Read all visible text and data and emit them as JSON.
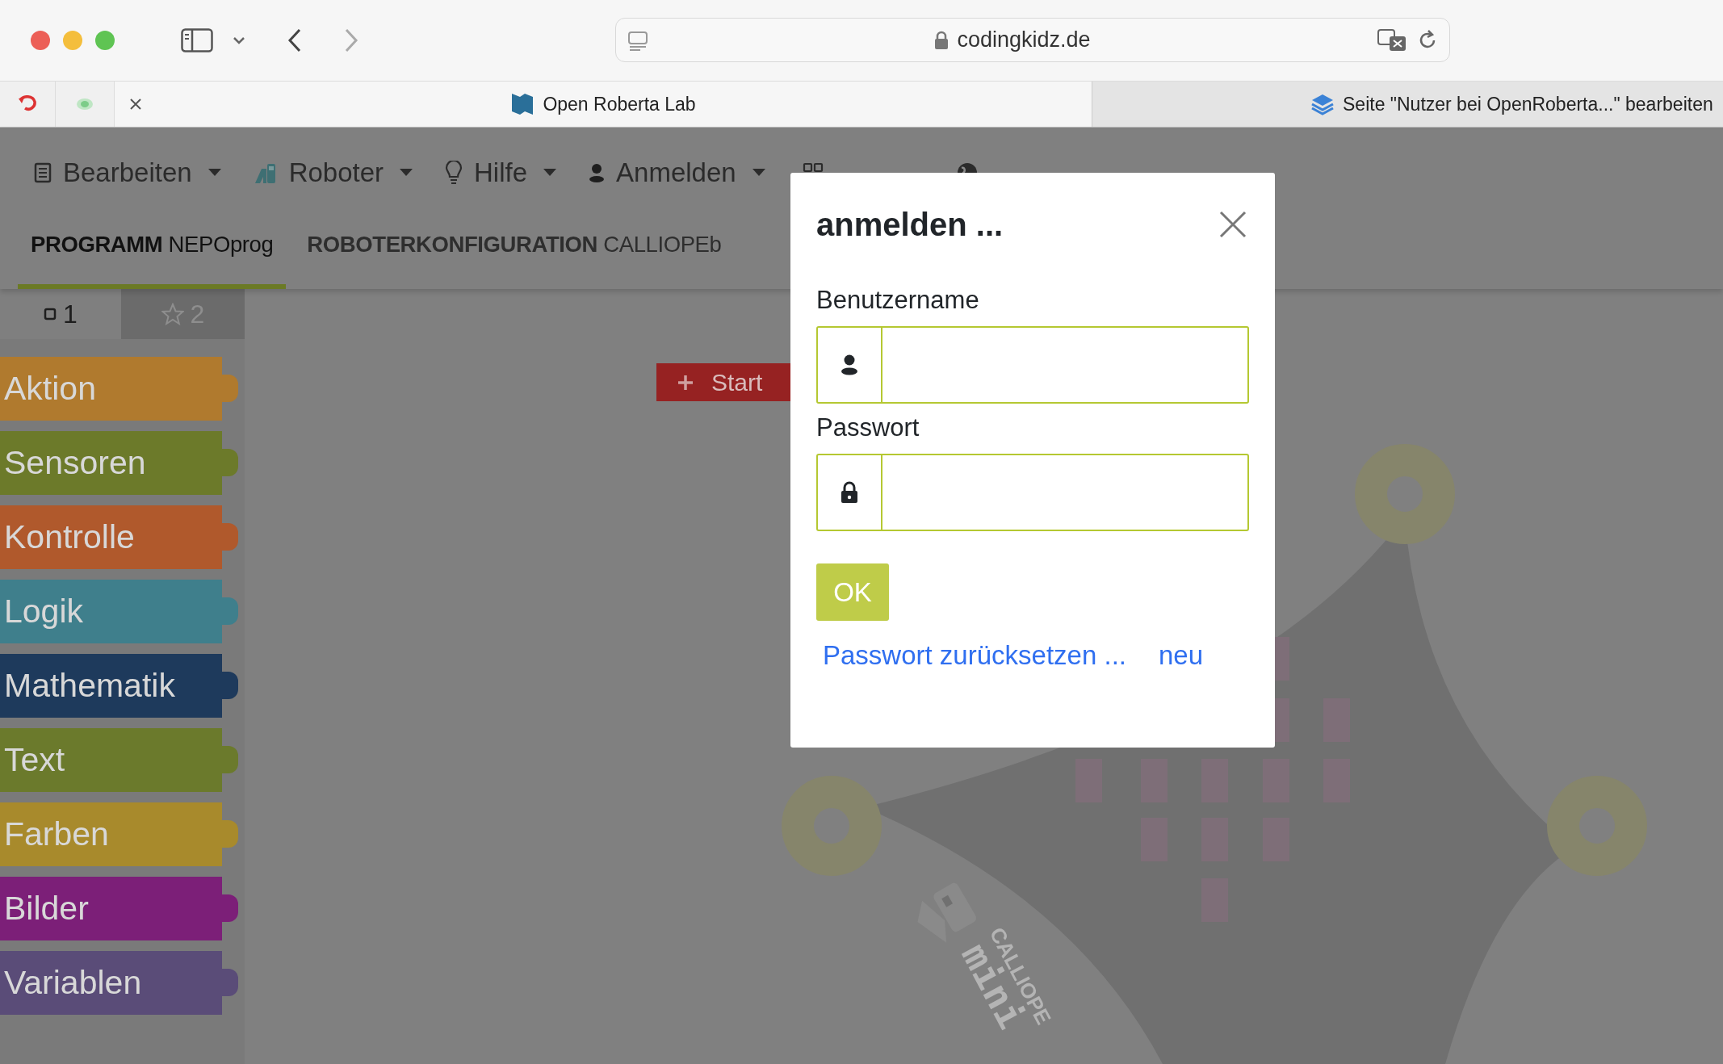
{
  "browser": {
    "address": "codingkidz.de",
    "tabs": [
      {
        "title": "Open Roberta Lab",
        "selected": true
      },
      {
        "title": "Seite \"Nutzer bei OpenRoberta...\" bearbeiten",
        "selected": false
      }
    ]
  },
  "menu": [
    {
      "label": "Bearbeiten"
    },
    {
      "label": "Roboter"
    },
    {
      "label": "Hilfe"
    },
    {
      "label": "Anmelden"
    }
  ],
  "program_tabs": [
    {
      "label": "**PROGRAMM** NEPOprog",
      "selected": true
    },
    {
      "label": "**ROBOTERKONFIGURATION** CALLIOPEb",
      "selected": false
    }
  ],
  "toolbox_tabs": [
    {
      "label": "1",
      "selected": true
    },
    {
      "label": "2",
      "selected": false
    }
  ],
  "toolbox": [
    {
      "label": "Aktion",
      "color": "#b07a2e"
    },
    {
      "label": "Sensoren",
      "color": "#6c7a2a"
    },
    {
      "label": "Kontrolle",
      "color": "#b0592c"
    },
    {
      "label": "Logik",
      "color": "#3f7f8c"
    },
    {
      "label": "Mathematik",
      "color": "#1e3a5c"
    },
    {
      "label": "Text",
      "color": "#6b7a2c"
    },
    {
      "label": "Farben",
      "color": "#a88a2c"
    },
    {
      "label": "Bilder",
      "color": "#7c1f78"
    },
    {
      "label": "Variablen",
      "color": "#5a4c78"
    }
  ],
  "canvas": {
    "start_block": "Start",
    "board_label": [
      "CALLIOPE",
      "mini"
    ]
  },
  "dialog": {
    "title": "anmelden ...",
    "fields": [
      {
        "label": "Benutzername",
        "kind": "user"
      },
      {
        "label": "Passwort",
        "kind": "password"
      }
    ],
    "ok_button": "OK",
    "links": [
      "Passwort zurücksetzen ...",
      "neu"
    ]
  }
}
